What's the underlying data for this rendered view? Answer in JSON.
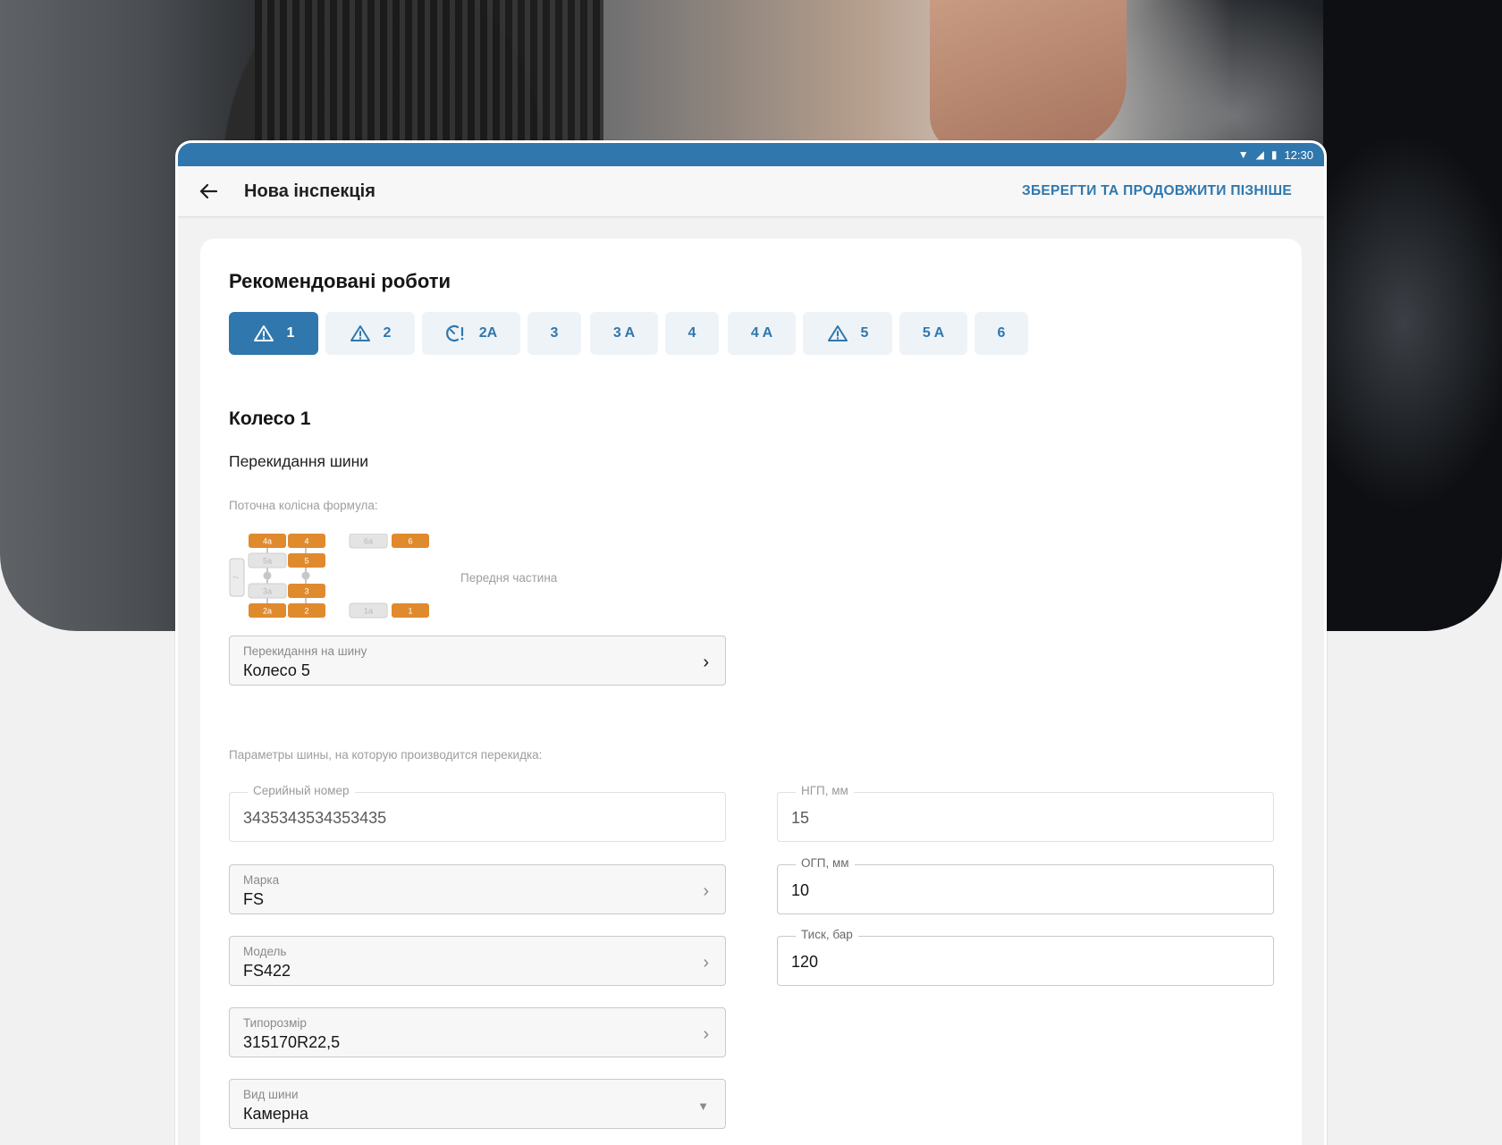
{
  "status": {
    "time": "12:30"
  },
  "appbar": {
    "title": "Нова інспекція",
    "save_later": "ЗБЕРЕГТИ ТА ПРОДОВЖИТИ ПІЗНІШЕ"
  },
  "recommended": {
    "title": "Рекомендовані роботи",
    "chips": [
      {
        "label": "1",
        "icon": "warning-icon",
        "active": true
      },
      {
        "label": "2",
        "icon": "warning-icon",
        "active": false
      },
      {
        "label": "2A",
        "icon": "gauge-alert-icon",
        "active": false
      },
      {
        "label": "3",
        "icon": "",
        "active": false
      },
      {
        "label": "3 A",
        "icon": "",
        "active": false
      },
      {
        "label": "4",
        "icon": "",
        "active": false
      },
      {
        "label": "4 A",
        "icon": "",
        "active": false
      },
      {
        "label": "5",
        "icon": "warning-icon",
        "active": false
      },
      {
        "label": "5 A",
        "icon": "",
        "active": false
      },
      {
        "label": "6",
        "icon": "",
        "active": false
      }
    ]
  },
  "wheel": {
    "title": "Колесо 1",
    "subtitle": "Перекидання шини",
    "formula_label": "Поточна колісна формула:",
    "front_label": "Передня частина",
    "diagram": {
      "cells": [
        "4a",
        "4",
        "5a",
        "5",
        "3a",
        "3",
        "2a",
        "2",
        "6a",
        "6",
        "1a",
        "1",
        "7"
      ],
      "highlight": [
        "4a",
        "4",
        "5",
        "3",
        "2a",
        "2",
        "6",
        "1"
      ]
    }
  },
  "transfer": {
    "label": "Перекидання на шину",
    "value": "Колесо 5"
  },
  "params_label": "Параметры шины, на которую производится перекидка:",
  "fields": {
    "serial": {
      "label": "Серийный номер",
      "value": "3435343534353435"
    },
    "ngp": {
      "label": "НГП, мм",
      "value": "15"
    },
    "brand": {
      "label": "Марка",
      "value": "FS"
    },
    "ogp": {
      "label": "ОГП, мм",
      "value": "10"
    },
    "model": {
      "label": "Модель",
      "value": "FS422"
    },
    "pressure": {
      "label": "Тиск, бар",
      "value": "120"
    },
    "size": {
      "label": "Типорозмір",
      "value": "315170R22,5"
    },
    "type": {
      "label": "Вид шини",
      "value": "Камерна"
    }
  },
  "colors": {
    "accent": "#2f77ad",
    "wheel_orange": "#e08a2e",
    "wheel_grey": "#e4e4e4"
  }
}
